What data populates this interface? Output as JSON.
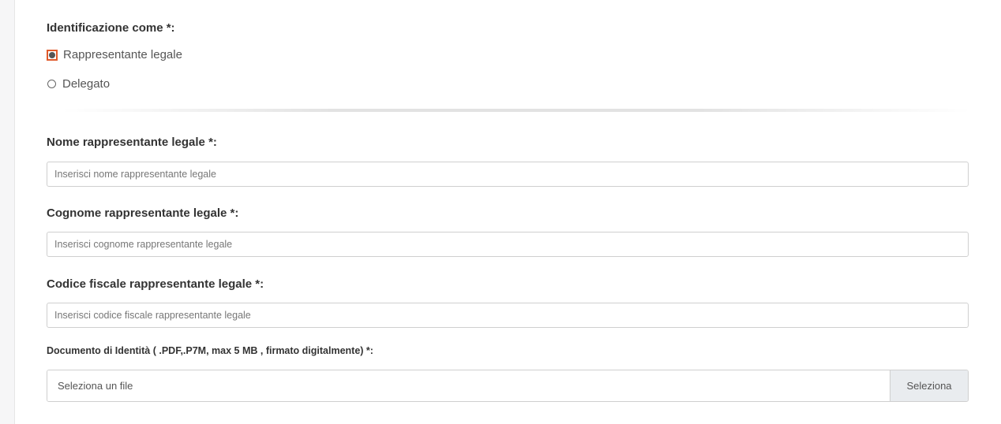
{
  "identification": {
    "title": "Identificazione come *:",
    "options": [
      {
        "label": "Rappresentante legale",
        "selected": true
      },
      {
        "label": "Delegato",
        "selected": false
      }
    ]
  },
  "fields": {
    "nome": {
      "label": "Nome rappresentante legale *:",
      "placeholder": "Inserisci nome rappresentante legale",
      "value": ""
    },
    "cognome": {
      "label": "Cognome rappresentante legale *:",
      "placeholder": "Inserisci cognome rappresentante legale",
      "value": ""
    },
    "codice_fiscale": {
      "label": "Codice fiscale rappresentante legale *:",
      "placeholder": "Inserisci codice fiscale rappresentante legale",
      "value": ""
    }
  },
  "document": {
    "label": "Documento di Identità ( .PDF,.P7M, max 5 MB , firmato digitalmente) *:",
    "file_placeholder": "Seleziona un file",
    "button_label": "Seleziona"
  },
  "colors": {
    "radio_accent": "#e05a2b",
    "input_border": "#cfcfcf",
    "button_bg": "#e9ecef"
  }
}
